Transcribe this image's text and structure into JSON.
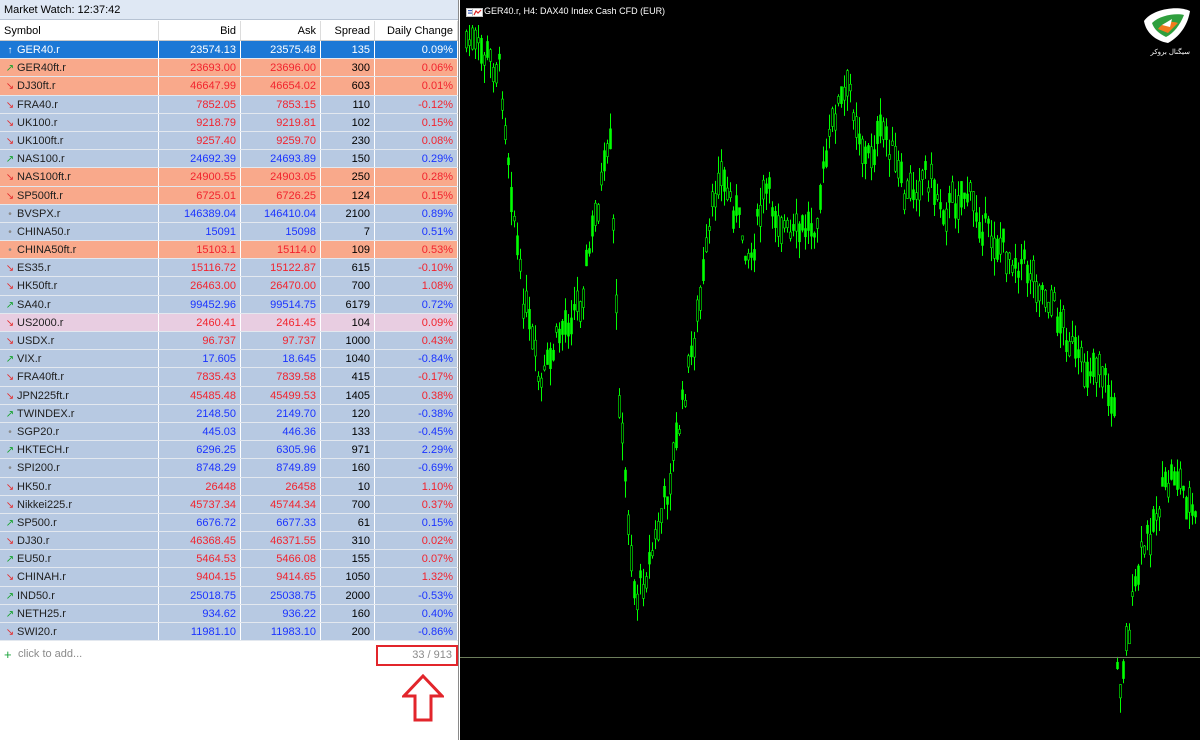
{
  "market_watch": {
    "title": "Market Watch: 12:37:42",
    "columns": {
      "symbol": "Symbol",
      "bid": "Bid",
      "ask": "Ask",
      "spread": "Spread",
      "change": "Daily Change"
    },
    "rows": [
      {
        "arrow": "↑",
        "dir": "flat",
        "symbol": "GER40.r",
        "bid": "23574.13",
        "ask": "23575.48",
        "spread": "135",
        "change": "0.09%",
        "bg": "sel",
        "color": "up"
      },
      {
        "arrow": "↗",
        "dir": "up",
        "symbol": "GER40ft.r",
        "bid": "23693.00",
        "ask": "23696.00",
        "spread": "300",
        "change": "0.06%",
        "bg": "orange",
        "color": "down"
      },
      {
        "arrow": "↘",
        "dir": "down",
        "symbol": "DJ30ft.r",
        "bid": "46647.99",
        "ask": "46654.02",
        "spread": "603",
        "change": "0.01%",
        "bg": "orange",
        "color": "down"
      },
      {
        "arrow": "↘",
        "dir": "down",
        "symbol": "FRA40.r",
        "bid": "7852.05",
        "ask": "7853.15",
        "spread": "110",
        "change": "-0.12%",
        "bg": "blue",
        "color": "down"
      },
      {
        "arrow": "↘",
        "dir": "down",
        "symbol": "UK100.r",
        "bid": "9218.79",
        "ask": "9219.81",
        "spread": "102",
        "change": "0.15%",
        "bg": "blue",
        "color": "down"
      },
      {
        "arrow": "↘",
        "dir": "down",
        "symbol": "UK100ft.r",
        "bid": "9257.40",
        "ask": "9259.70",
        "spread": "230",
        "change": "0.08%",
        "bg": "blue",
        "color": "down"
      },
      {
        "arrow": "↗",
        "dir": "up",
        "symbol": "NAS100.r",
        "bid": "24692.39",
        "ask": "24693.89",
        "spread": "150",
        "change": "0.29%",
        "bg": "blue",
        "color": "up"
      },
      {
        "arrow": "↘",
        "dir": "down",
        "symbol": "NAS100ft.r",
        "bid": "24900.55",
        "ask": "24903.05",
        "spread": "250",
        "change": "0.28%",
        "bg": "orange",
        "color": "down"
      },
      {
        "arrow": "↘",
        "dir": "down",
        "symbol": "SP500ft.r",
        "bid": "6725.01",
        "ask": "6726.25",
        "spread": "124",
        "change": "0.15%",
        "bg": "orange",
        "color": "down"
      },
      {
        "arrow": "•",
        "dir": "flat",
        "symbol": "BVSPX.r",
        "bid": "146389.04",
        "ask": "146410.04",
        "spread": "2100",
        "change": "0.89%",
        "bg": "blue",
        "color": "up"
      },
      {
        "arrow": "•",
        "dir": "flat",
        "symbol": "CHINA50.r",
        "bid": "15091",
        "ask": "15098",
        "spread": "7",
        "change": "0.51%",
        "bg": "blue",
        "color": "up"
      },
      {
        "arrow": "•",
        "dir": "flat",
        "symbol": "CHINA50ft.r",
        "bid": "15103.1",
        "ask": "15114.0",
        "spread": "109",
        "change": "0.53%",
        "bg": "orange",
        "color": "down"
      },
      {
        "arrow": "↘",
        "dir": "down",
        "symbol": "ES35.r",
        "bid": "15116.72",
        "ask": "15122.87",
        "spread": "615",
        "change": "-0.10%",
        "bg": "blue",
        "color": "down"
      },
      {
        "arrow": "↘",
        "dir": "down",
        "symbol": "HK50ft.r",
        "bid": "26463.00",
        "ask": "26470.00",
        "spread": "700",
        "change": "1.08%",
        "bg": "blue",
        "color": "down"
      },
      {
        "arrow": "↗",
        "dir": "up",
        "symbol": "SA40.r",
        "bid": "99452.96",
        "ask": "99514.75",
        "spread": "6179",
        "change": "0.72%",
        "bg": "blue",
        "color": "up"
      },
      {
        "arrow": "↘",
        "dir": "down",
        "symbol": "US2000.r",
        "bid": "2460.41",
        "ask": "2461.45",
        "spread": "104",
        "change": "0.09%",
        "bg": "pink",
        "color": "down"
      },
      {
        "arrow": "↘",
        "dir": "down",
        "symbol": "USDX.r",
        "bid": "96.737",
        "ask": "97.737",
        "spread": "1000",
        "change": "0.43%",
        "bg": "blue",
        "color": "down"
      },
      {
        "arrow": "↗",
        "dir": "up",
        "symbol": "VIX.r",
        "bid": "17.605",
        "ask": "18.645",
        "spread": "1040",
        "change": "-0.84%",
        "bg": "blue",
        "color": "up"
      },
      {
        "arrow": "↘",
        "dir": "down",
        "symbol": "FRA40ft.r",
        "bid": "7835.43",
        "ask": "7839.58",
        "spread": "415",
        "change": "-0.17%",
        "bg": "blue",
        "color": "down"
      },
      {
        "arrow": "↘",
        "dir": "down",
        "symbol": "JPN225ft.r",
        "bid": "45485.48",
        "ask": "45499.53",
        "spread": "1405",
        "change": "0.38%",
        "bg": "blue",
        "color": "down"
      },
      {
        "arrow": "↗",
        "dir": "up",
        "symbol": "TWINDEX.r",
        "bid": "2148.50",
        "ask": "2149.70",
        "spread": "120",
        "change": "-0.38%",
        "bg": "blue",
        "color": "up"
      },
      {
        "arrow": "•",
        "dir": "flat",
        "symbol": "SGP20.r",
        "bid": "445.03",
        "ask": "446.36",
        "spread": "133",
        "change": "-0.45%",
        "bg": "blue",
        "color": "up"
      },
      {
        "arrow": "↗",
        "dir": "up",
        "symbol": "HKTECH.r",
        "bid": "6296.25",
        "ask": "6305.96",
        "spread": "971",
        "change": "2.29%",
        "bg": "blue",
        "color": "up"
      },
      {
        "arrow": "•",
        "dir": "flat",
        "symbol": "SPI200.r",
        "bid": "8748.29",
        "ask": "8749.89",
        "spread": "160",
        "change": "-0.69%",
        "bg": "blue",
        "color": "up"
      },
      {
        "arrow": "↘",
        "dir": "down",
        "symbol": "HK50.r",
        "bid": "26448",
        "ask": "26458",
        "spread": "10",
        "change": "1.10%",
        "bg": "blue",
        "color": "down"
      },
      {
        "arrow": "↘",
        "dir": "down",
        "symbol": "Nikkei225.r",
        "bid": "45737.34",
        "ask": "45744.34",
        "spread": "700",
        "change": "0.37%",
        "bg": "blue",
        "color": "down"
      },
      {
        "arrow": "↗",
        "dir": "up",
        "symbol": "SP500.r",
        "bid": "6676.72",
        "ask": "6677.33",
        "spread": "61",
        "change": "0.15%",
        "bg": "blue",
        "color": "up"
      },
      {
        "arrow": "↘",
        "dir": "down",
        "symbol": "DJ30.r",
        "bid": "46368.45",
        "ask": "46371.55",
        "spread": "310",
        "change": "0.02%",
        "bg": "blue",
        "color": "down"
      },
      {
        "arrow": "↗",
        "dir": "up",
        "symbol": "EU50.r",
        "bid": "5464.53",
        "ask": "5466.08",
        "spread": "155",
        "change": "0.07%",
        "bg": "blue",
        "color": "down"
      },
      {
        "arrow": "↘",
        "dir": "down",
        "symbol": "CHINAH.r",
        "bid": "9404.15",
        "ask": "9414.65",
        "spread": "1050",
        "change": "1.32%",
        "bg": "blue",
        "color": "down"
      },
      {
        "arrow": "↗",
        "dir": "up",
        "symbol": "IND50.r",
        "bid": "25018.75",
        "ask": "25038.75",
        "spread": "2000",
        "change": "-0.53%",
        "bg": "blue",
        "color": "up"
      },
      {
        "arrow": "↗",
        "dir": "up",
        "symbol": "NETH25.r",
        "bid": "934.62",
        "ask": "936.22",
        "spread": "160",
        "change": "0.40%",
        "bg": "blue",
        "color": "up"
      },
      {
        "arrow": "↘",
        "dir": "down",
        "symbol": "SWI20.r",
        "bid": "11981.10",
        "ask": "11983.10",
        "spread": "200",
        "change": "-0.86%",
        "bg": "blue",
        "color": "up"
      }
    ],
    "add_label": "click to add...",
    "count": "33 / 913"
  },
  "chart": {
    "title": "GER40.r, H4:  DAX40 Index Cash CFD (EUR)",
    "logo_text": "سیگنال بروکر",
    "candle_color": "#00ff00",
    "background": "#000000"
  },
  "colors": {
    "up": "#1a33ff",
    "down": "#f2232d",
    "highlight": "#e2252b"
  }
}
